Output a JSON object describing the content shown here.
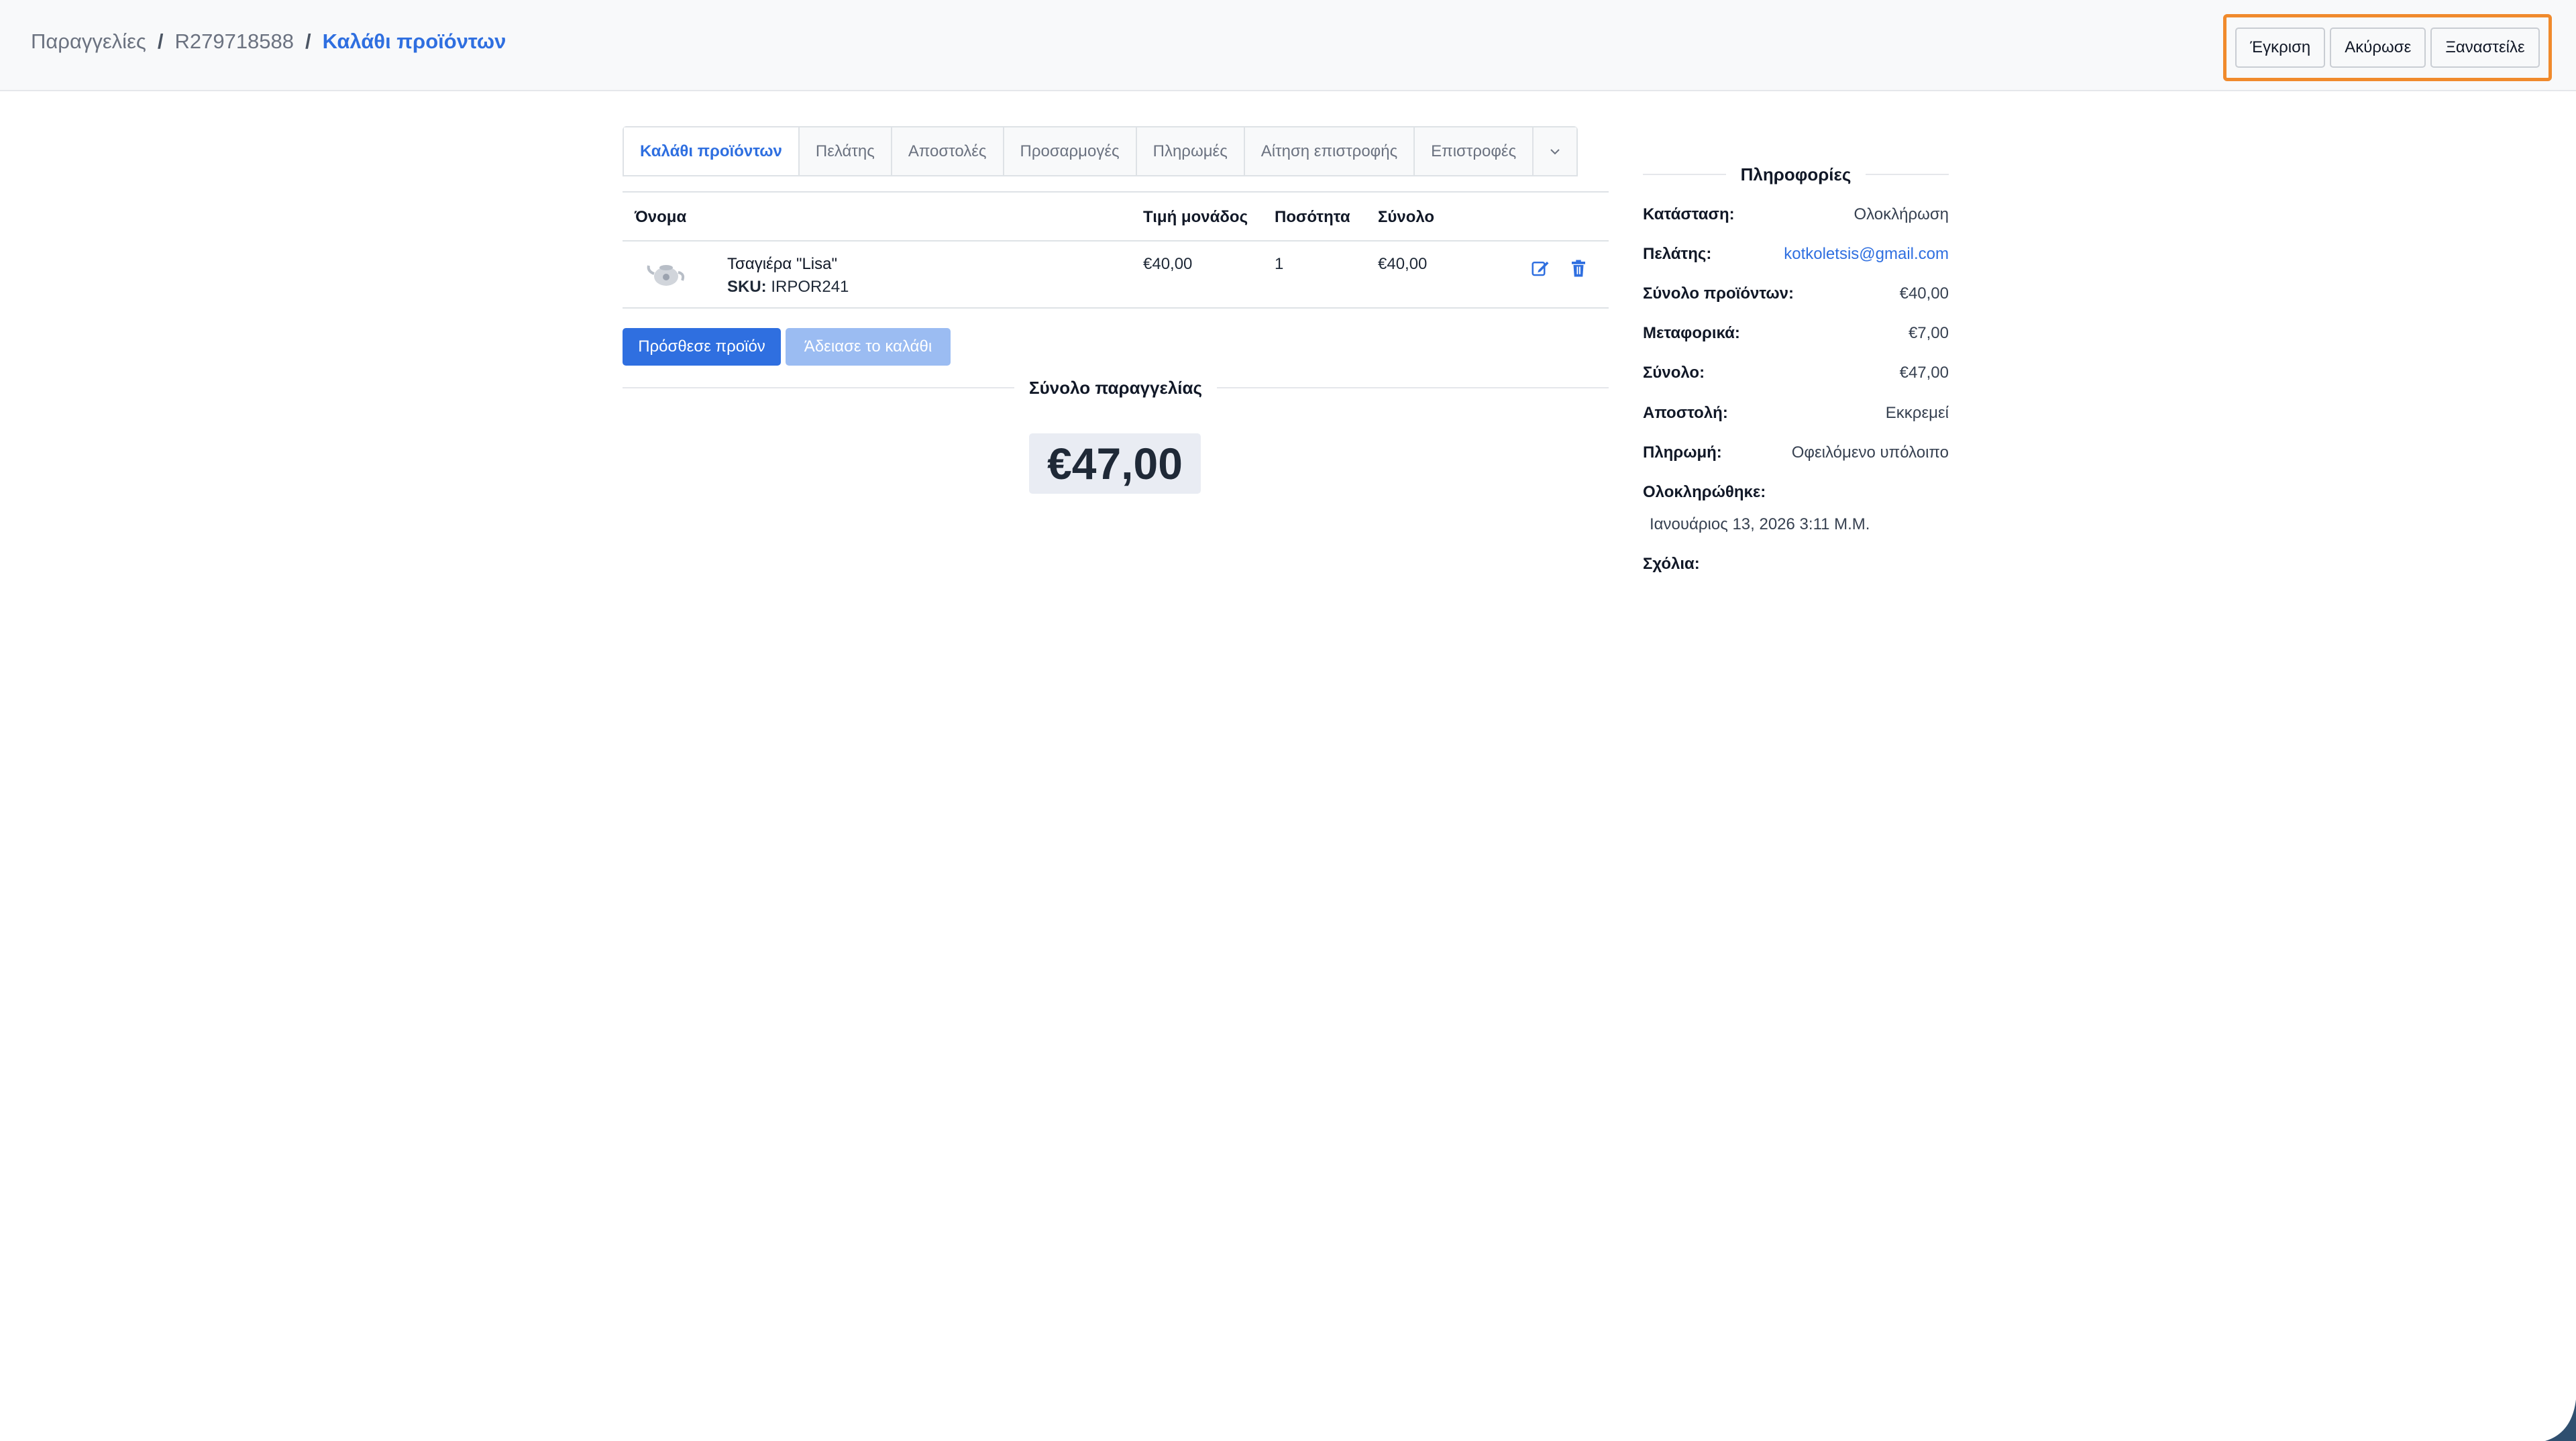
{
  "breadcrumb": {
    "orders": "Παραγγελίες",
    "separator": "/",
    "order_id": "R279718588",
    "current": "Καλάθι προϊόντων"
  },
  "header_actions": {
    "approve": "Έγκριση",
    "cancel": "Ακύρωσε",
    "resend": "Ξαναστείλε"
  },
  "tabs": [
    {
      "label": "Καλάθι προϊόντων",
      "active": true
    },
    {
      "label": "Πελάτης",
      "active": false
    },
    {
      "label": "Αποστολές",
      "active": false
    },
    {
      "label": "Προσαρμογές",
      "active": false
    },
    {
      "label": "Πληρωμές",
      "active": false
    },
    {
      "label": "Αίτηση επιστροφής",
      "active": false
    },
    {
      "label": "Επιστροφές",
      "active": false
    }
  ],
  "tabs_more_icon": "chevron-down-icon",
  "table": {
    "headers": {
      "name": "Όνομα",
      "unit_price": "Τιμή μονάδος",
      "quantity": "Ποσότητα",
      "total": "Σύνολο"
    },
    "rows": [
      {
        "name": "Τσαγιέρα \"Lisa\"",
        "sku_label": "SKU:",
        "sku": "IRPOR241",
        "unit_price": "€40,00",
        "quantity": "1",
        "total": "€40,00",
        "image_icon": "teapot-icon",
        "edit_icon": "edit-icon",
        "delete_icon": "trash-icon"
      }
    ]
  },
  "buttons": {
    "add_product": "Πρόσθεσε προϊόν",
    "empty_cart": "Άδειασε το καλάθι"
  },
  "order_total": {
    "title": "Σύνολο παραγγελίας",
    "amount": "€47,00"
  },
  "info": {
    "title": "Πληροφορίες",
    "status_label": "Κατάσταση:",
    "status": "Ολοκλήρωση",
    "customer_label": "Πελάτης:",
    "customer": "kotkoletsis@gmail.com",
    "items_total_label": "Σύνολο προϊόντων:",
    "items_total": "€40,00",
    "shipping_label": "Μεταφορικά:",
    "shipping": "€7,00",
    "total_label": "Σύνολο:",
    "total": "€47,00",
    "shipment_label": "Αποστολή:",
    "shipment": "Εκκρεμεί",
    "payment_label": "Πληρωμή:",
    "payment": "Οφειλόμενο υπόλοιπο",
    "completed_label": "Ολοκληρώθηκε:",
    "completed": "Ιανουάριος 13, 2026 3:11 Μ.Μ.",
    "comments_label": "Σχόλια:"
  },
  "colors": {
    "accent": "#2f6fe0",
    "highlight_border": "#f08a2c",
    "disabled_button": "#9bbcf2"
  }
}
